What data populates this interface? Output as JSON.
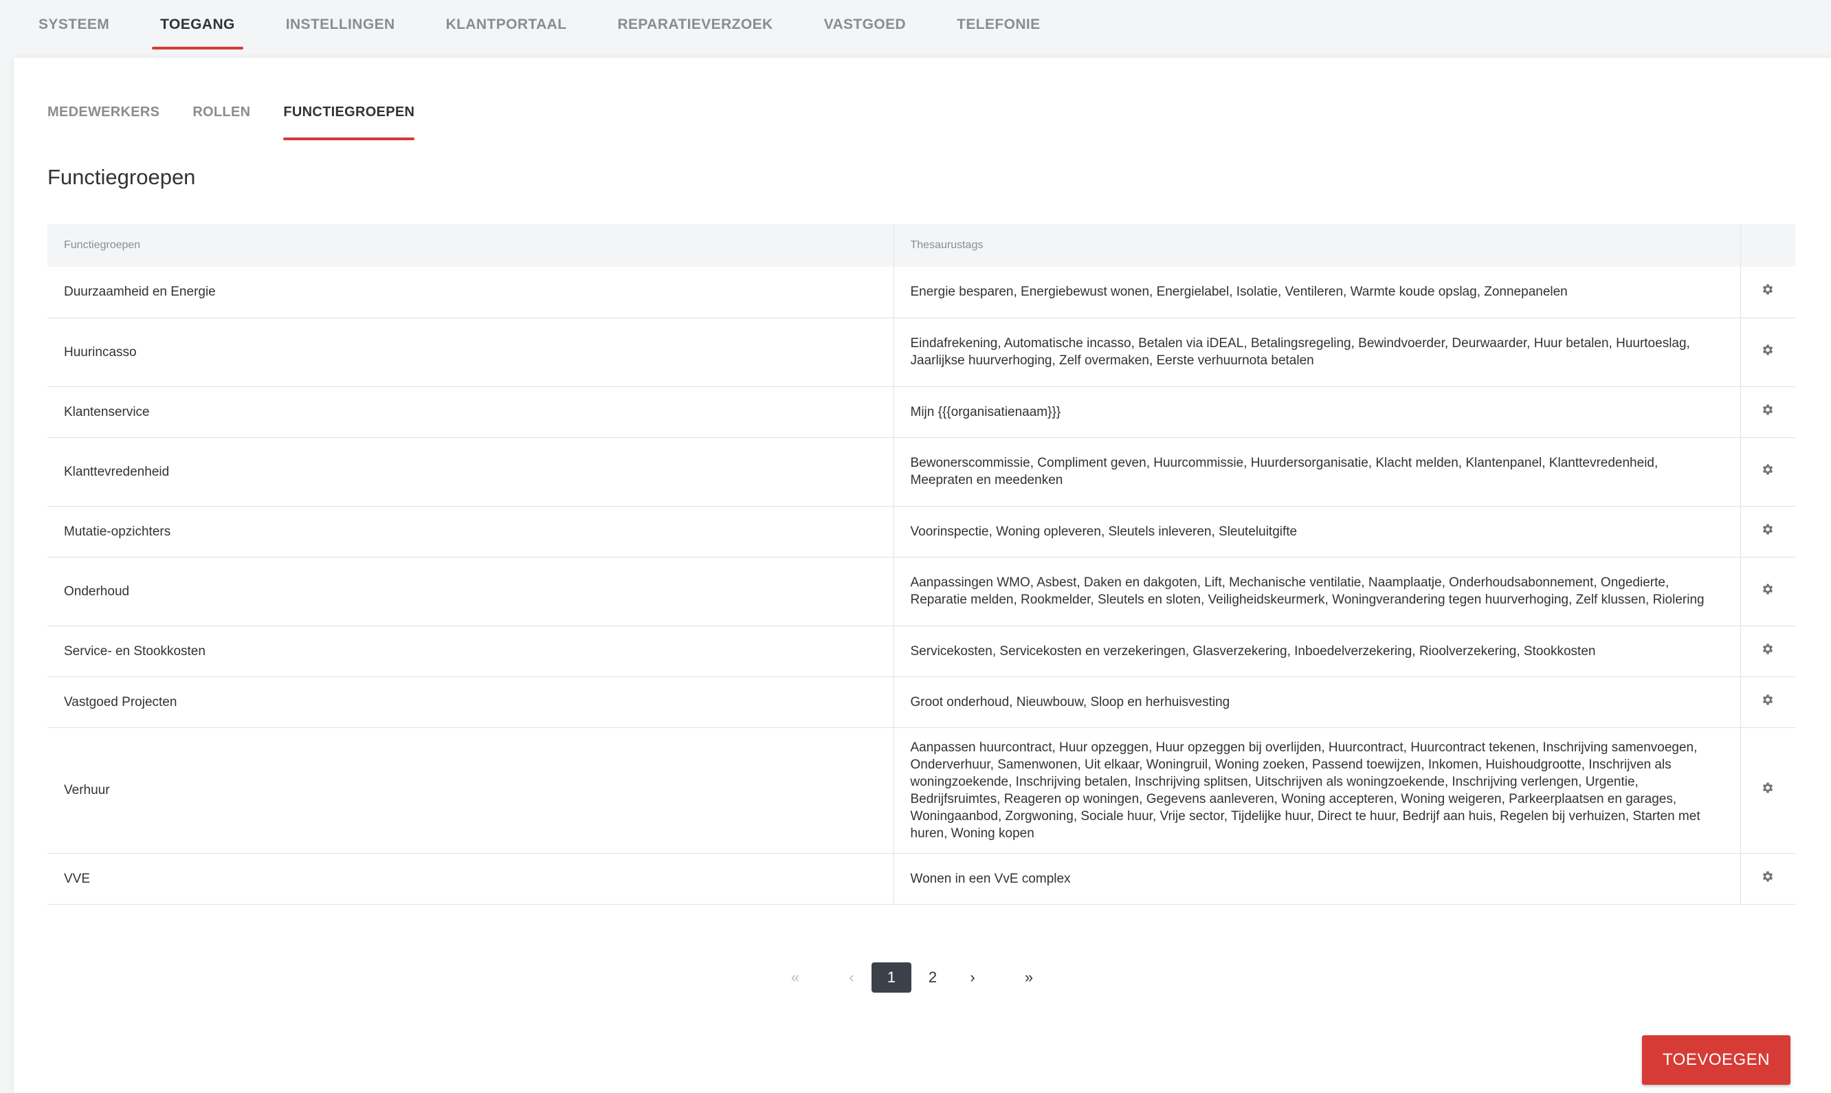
{
  "top_nav": {
    "tabs": [
      {
        "label": "SYSTEEM",
        "active": false
      },
      {
        "label": "TOEGANG",
        "active": true
      },
      {
        "label": "INSTELLINGEN",
        "active": false
      },
      {
        "label": "KLANTPORTAAL",
        "active": false
      },
      {
        "label": "REPARATIEVERZOEK",
        "active": false
      },
      {
        "label": "VASTGOED",
        "active": false
      },
      {
        "label": "TELEFONIE",
        "active": false
      }
    ]
  },
  "sub_nav": {
    "tabs": [
      {
        "label": "MEDEWERKERS",
        "active": false
      },
      {
        "label": "ROLLEN",
        "active": false
      },
      {
        "label": "FUNCTIEGROEPEN",
        "active": true
      }
    ]
  },
  "page": {
    "title": "Functiegroepen"
  },
  "table": {
    "headers": {
      "name": "Functiegroepen",
      "tags": "Thesaurustags",
      "actions": ""
    },
    "rows": [
      {
        "name": "Duurzaamheid en Energie",
        "tags": "Energie besparen, Energiebewust wonen, Energielabel, Isolatie, Ventileren, Warmte koude opslag, Zonnepanelen"
      },
      {
        "name": "Huurincasso",
        "tags": "Eindafrekening, Automatische incasso, Betalen via iDEAL, Betalingsregeling, Bewindvoerder, Deurwaarder, Huur betalen, Huurtoeslag, Jaarlijkse huurverhoging, Zelf overmaken, Eerste verhuurnota betalen"
      },
      {
        "name": "Klantenservice",
        "tags": "Mijn {{{organisatienaam}}}"
      },
      {
        "name": "Klanttevredenheid",
        "tags": "Bewonerscommissie, Compliment geven, Huurcommissie, Huurdersorganisatie, Klacht melden, Klantenpanel, Klanttevredenheid, Meepraten en meedenken"
      },
      {
        "name": "Mutatie-opzichters",
        "tags": "Voorinspectie, Woning opleveren, Sleutels inleveren, Sleuteluitgifte"
      },
      {
        "name": "Onderhoud",
        "tags": "Aanpassingen WMO, Asbest, Daken en dakgoten, Lift, Mechanische ventilatie, Naamplaatje, Onderhoudsabonnement, Ongedierte, Reparatie melden, Rookmelder, Sleutels en sloten, Veiligheidskeurmerk, Woningverandering tegen huurverhoging, Zelf klussen, Riolering"
      },
      {
        "name": "Service- en Stookkosten",
        "tags": "Servicekosten, Servicekosten en verzekeringen, Glasverzekering, Inboedelverzekering, Rioolverzekering, Stookkosten"
      },
      {
        "name": "Vastgoed Projecten",
        "tags": "Groot onderhoud, Nieuwbouw, Sloop en herhuisvesting"
      },
      {
        "name": "Verhuur",
        "tags": "Aanpassen huurcontract, Huur opzeggen, Huur opzeggen bij overlijden, Huurcontract, Huurcontract tekenen, Inschrijving samenvoegen, Onderverhuur, Samenwonen, Uit elkaar, Woningruil, Woning zoeken, Passend toewijzen, Inkomen, Huishoudgrootte, Inschrijven als woningzoekende, Inschrijving betalen, Inschrijving splitsen, Uitschrijven als woningzoekende, Inschrijving verlengen, Urgentie, Bedrijfsruimtes, Reageren op woningen, Gegevens aanleveren, Woning accepteren, Woning weigeren, Parkeerplaatsen en garages, Woningaanbod, Zorgwoning, Sociale huur, Vrije sector, Tijdelijke huur, Direct te huur, Bedrijf aan huis, Regelen bij verhuizen, Starten met huren, Woning kopen"
      },
      {
        "name": "VVE",
        "tags": "Wonen in een VvE complex"
      }
    ],
    "row_action_icon": "gear-icon"
  },
  "pagination": {
    "first": "«",
    "prev": "‹",
    "pages": [
      "1",
      "2"
    ],
    "current": "1",
    "next": "›",
    "last": "»"
  },
  "actions": {
    "add_label": "TOEVOEGEN"
  },
  "colors": {
    "accent": "#d63b35",
    "pagination_active": "#3a4149",
    "text": "#2f3337",
    "muted": "#8a8d90"
  }
}
